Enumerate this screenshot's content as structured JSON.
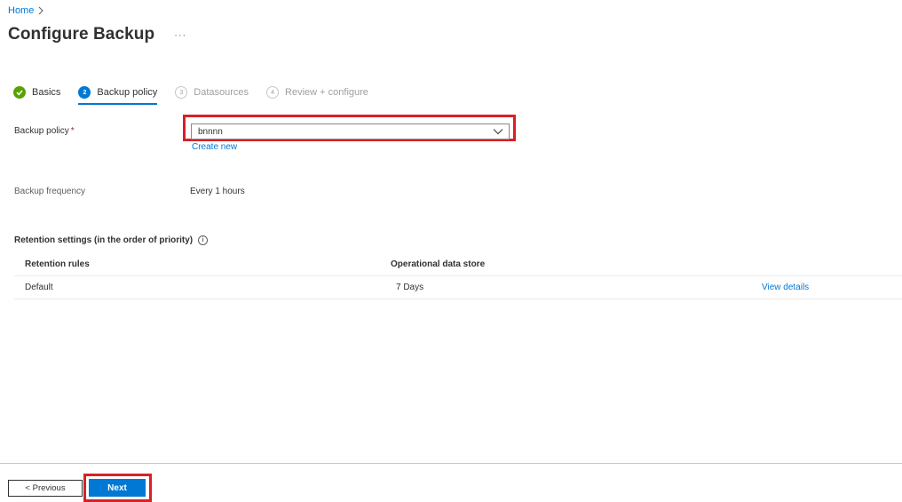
{
  "breadcrumb": {
    "home": "Home"
  },
  "page": {
    "title": "Configure Backup",
    "more": "···"
  },
  "steps": [
    {
      "number": "",
      "label": "Basics",
      "state": "done"
    },
    {
      "number": "2",
      "label": "Backup policy",
      "state": "active"
    },
    {
      "number": "3",
      "label": "Datasources",
      "state": "future"
    },
    {
      "number": "4",
      "label": "Review + configure",
      "state": "future"
    }
  ],
  "policy": {
    "label": "Backup policy",
    "required_mark": "*",
    "selected": "bnnnn",
    "create_new": "Create new"
  },
  "frequency": {
    "label": "Backup frequency",
    "value": "Every 1 hours"
  },
  "retention": {
    "title": "Retention settings (in the order of priority)",
    "columns": [
      "Retention rules",
      "Operational data store"
    ],
    "rows": [
      {
        "rule": "Default",
        "store": "7 Days",
        "action": "View details"
      }
    ]
  },
  "footer": {
    "previous": "< Previous",
    "next": "Next"
  },
  "colors": {
    "accent": "#0078d4",
    "success": "#57a300",
    "highlight": "#d92027",
    "required": "#a4262c"
  }
}
